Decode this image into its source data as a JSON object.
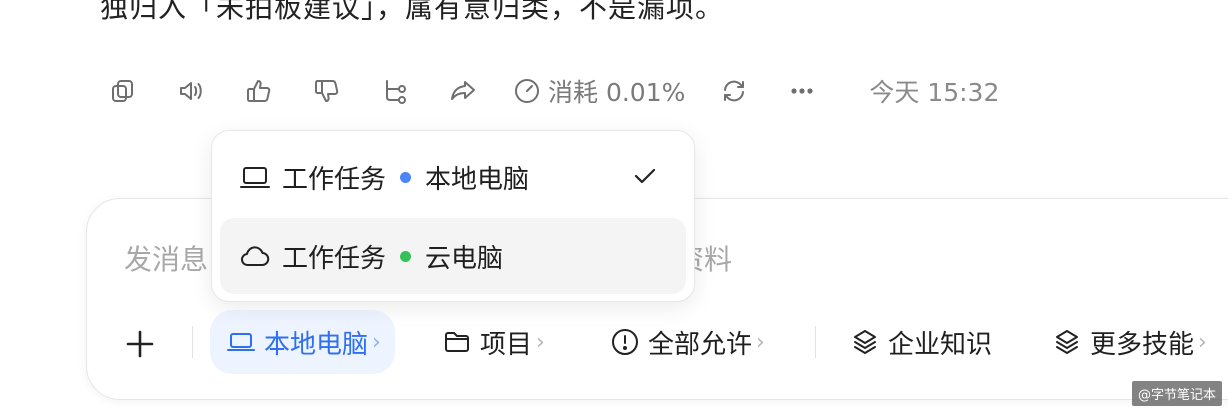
{
  "message": {
    "partial_text": "独归入「未拍板建议」，属有意归类，不是漏项。"
  },
  "actions": {
    "copy_icon": "copy-icon",
    "speaker_icon": "speaker-icon",
    "like_icon": "thumbs-up-icon",
    "dislike_icon": "thumbs-down-icon",
    "branch_icon": "branch-icon",
    "share_icon": "share-icon",
    "consume_label": "消耗 0.01%",
    "regenerate_icon": "refresh-icon",
    "more_icon": "more-icon",
    "timestamp": "今天 15:32"
  },
  "composer": {
    "placeholder_left": "发消息",
    "placeholder_right": "资料",
    "toolbar": {
      "device_label": "本地电脑",
      "project_label": "项目",
      "permission_label": "全部允许",
      "knowledge_label": "企业知识",
      "skills_label": "更多技能",
      "arrow": "›"
    }
  },
  "dropdown": {
    "options": [
      {
        "task": "工作任务",
        "target": "本地电脑",
        "dot_color": "#4a86f7",
        "icon": "laptop-icon",
        "selected": true
      },
      {
        "task": "工作任务",
        "target": "云电脑",
        "dot_color": "#35c159",
        "icon": "cloud-icon",
        "selected": false
      }
    ]
  },
  "colors": {
    "accent": "#2f6ff2",
    "chip_bg": "#eef4ff"
  },
  "watermark": "@字节笔记本"
}
